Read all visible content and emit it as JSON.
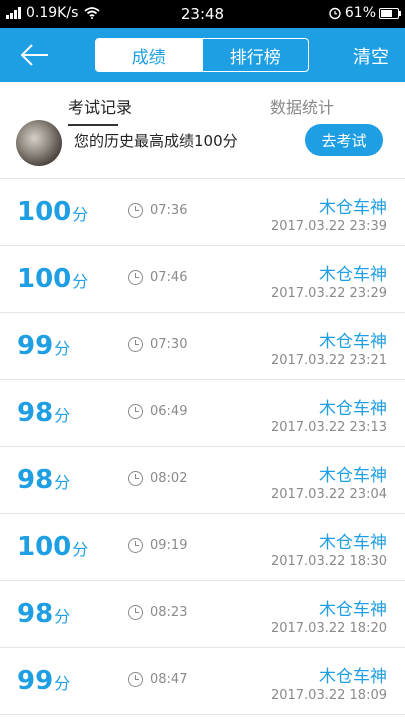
{
  "status": {
    "speed": "0.19K/s",
    "time": "23:48",
    "battery": "61%"
  },
  "header": {
    "tab_scores": "成绩",
    "tab_ranking": "排行榜",
    "clear": "清空"
  },
  "tabs": {
    "records": "考试记录",
    "stats": "数据统计"
  },
  "best": {
    "text": "您的历史最高成绩100分",
    "button": "去考试"
  },
  "records": [
    {
      "score": "100",
      "unit": "分",
      "duration": "07:36",
      "name": "木仓车神",
      "date": "2017.03.22  23:39"
    },
    {
      "score": "100",
      "unit": "分",
      "duration": "07:46",
      "name": "木仓车神",
      "date": "2017.03.22  23:29"
    },
    {
      "score": "99",
      "unit": "分",
      "duration": "07:30",
      "name": "木仓车神",
      "date": "2017.03.22  23:21"
    },
    {
      "score": "98",
      "unit": "分",
      "duration": "06:49",
      "name": "木仓车神",
      "date": "2017.03.22  23:13"
    },
    {
      "score": "98",
      "unit": "分",
      "duration": "08:02",
      "name": "木仓车神",
      "date": "2017.03.22  23:04"
    },
    {
      "score": "100",
      "unit": "分",
      "duration": "09:19",
      "name": "木仓车神",
      "date": "2017.03.22  18:30"
    },
    {
      "score": "98",
      "unit": "分",
      "duration": "08:23",
      "name": "木仓车神",
      "date": "2017.03.22  18:20"
    },
    {
      "score": "99",
      "unit": "分",
      "duration": "08:47",
      "name": "木仓车神",
      "date": "2017.03.22  18:09"
    }
  ],
  "colors": {
    "accent": "#1e9fe3",
    "muted": "#8a8a8a"
  }
}
